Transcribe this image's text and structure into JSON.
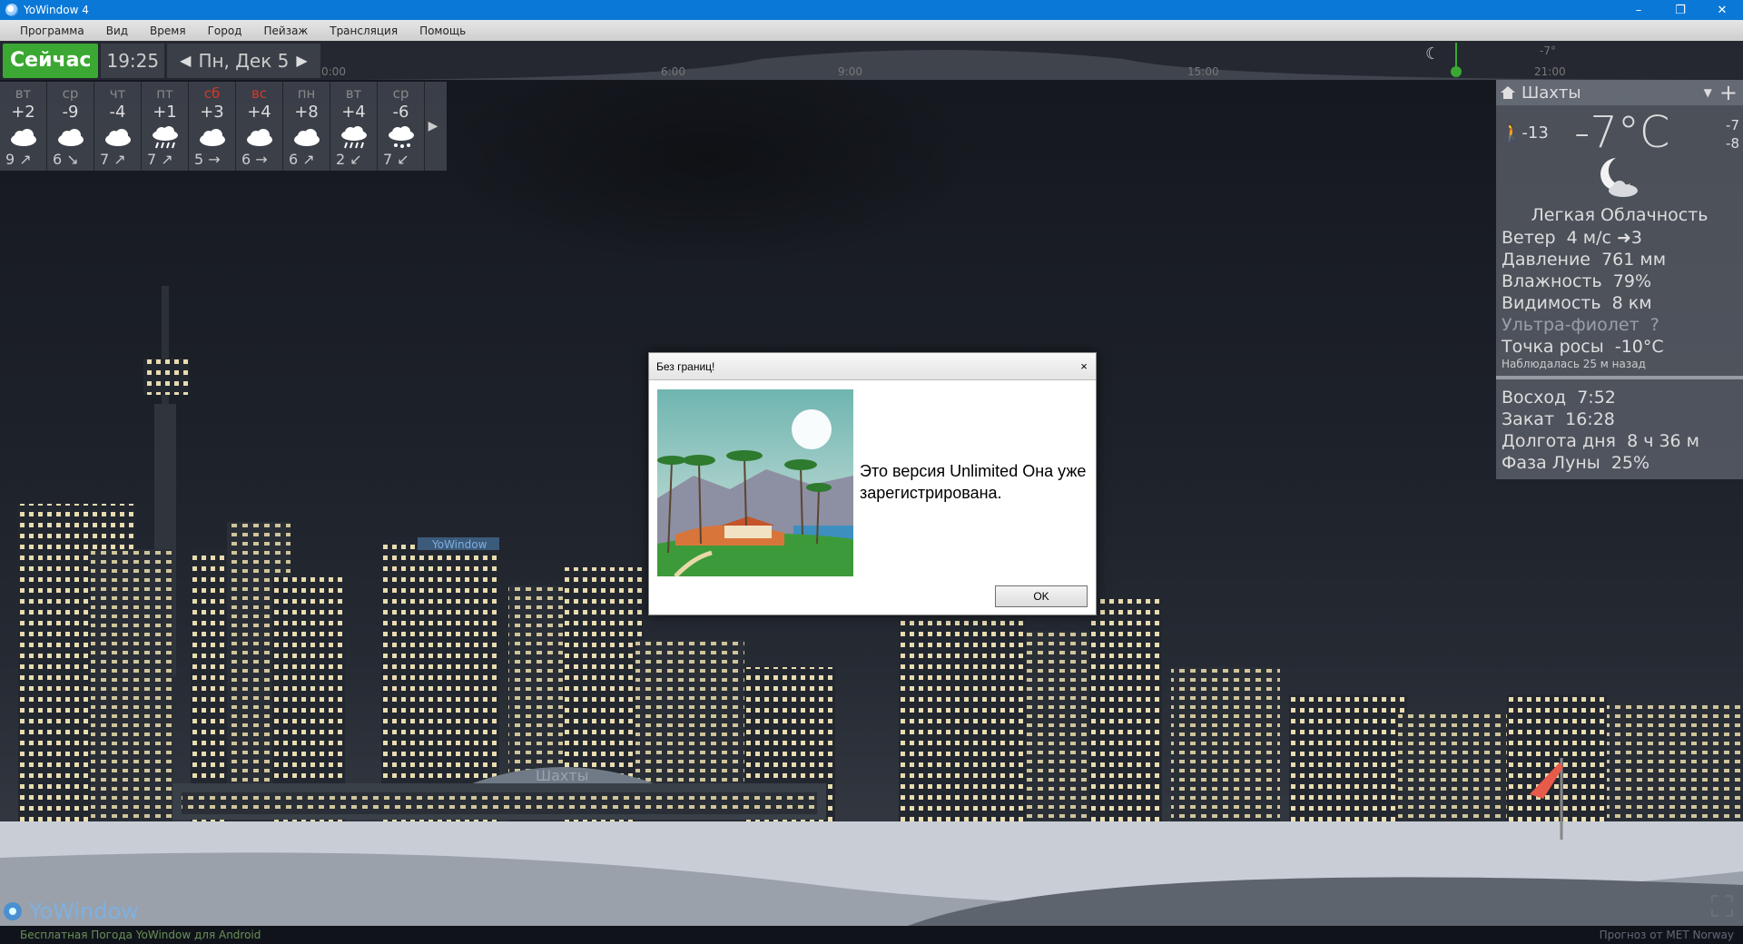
{
  "window": {
    "title": "YoWindow 4",
    "minimize": "–",
    "restore": "❐",
    "close": "✕"
  },
  "menu": [
    "Программа",
    "Вид",
    "Время",
    "Город",
    "Пейзаж",
    "Трансляция",
    "Помощь"
  ],
  "timebar": {
    "now_label": "Сейчас",
    "time": "19:25",
    "date": "Пн, Дек 5",
    "timeline_labels": [
      "0:00",
      "6:00",
      "9:00",
      "15:00",
      "21:00"
    ],
    "timeline_temp": "-7°"
  },
  "forecast": [
    {
      "day": "вт",
      "temp": "+2",
      "icon": "cloud-icon",
      "wind": "9 ↗",
      "weekend": false
    },
    {
      "day": "ср",
      "temp": "-9",
      "icon": "cloud-icon",
      "wind": "6 ↘",
      "weekend": false
    },
    {
      "day": "чт",
      "temp": "-4",
      "icon": "cloud-icon",
      "wind": "7 ↗",
      "weekend": false
    },
    {
      "day": "пт",
      "temp": "+1",
      "icon": "rain-icon",
      "wind": "7 ↗",
      "weekend": false
    },
    {
      "day": "сб",
      "temp": "+3",
      "icon": "cloud-icon",
      "wind": "5 →",
      "weekend": true
    },
    {
      "day": "вс",
      "temp": "+4",
      "icon": "cloud-icon",
      "wind": "6 →",
      "weekend": true
    },
    {
      "day": "пн",
      "temp": "+8",
      "icon": "cloud-icon",
      "wind": "6 ↗",
      "weekend": false
    },
    {
      "day": "вт",
      "temp": "+4",
      "icon": "rain-icon",
      "wind": "2 ↙",
      "weekend": false
    },
    {
      "day": "ср",
      "temp": "-6",
      "icon": "snow-icon",
      "wind": "7 ↙",
      "weekend": false
    }
  ],
  "panel": {
    "city": "Шахты",
    "feels_like": "-13",
    "temperature": "-7°C",
    "max": "-7",
    "min": "-8",
    "condition": "Легкая Облачность",
    "rows": [
      {
        "label": "Ветер",
        "value": "4 м/с ➜3",
        "dim": false
      },
      {
        "label": "Давление",
        "value": "761 мм",
        "dim": false
      },
      {
        "label": "Влажность",
        "value": "79%",
        "dim": false
      },
      {
        "label": "Видимость",
        "value": "8 км",
        "dim": false
      },
      {
        "label": "Ультра-фиолет",
        "value": "?",
        "dim": true
      },
      {
        "label": "Точка росы",
        "value": "-10°C",
        "dim": false
      }
    ],
    "observed": "Наблюдалась 25 м назад",
    "astro": [
      {
        "label": "Восход",
        "value": "7:52"
      },
      {
        "label": "Закат",
        "value": "16:28"
      },
      {
        "label": "Долгота дня",
        "value": "8 ч 36 м"
      },
      {
        "label": "Фаза Луны",
        "value": "25%"
      }
    ]
  },
  "scene": {
    "station_sign": "Шахты",
    "billboard": "YoWindow"
  },
  "dialog": {
    "title": "Без границ!",
    "close": "×",
    "message": "Это версия Unlimited Она уже зарегистрирована.",
    "ok": "OK"
  },
  "logo": "YoWindow",
  "status": {
    "left": "Бесплатная Погода YoWindow для Android",
    "right": "Прогноз от MET Norway"
  },
  "colors": {
    "titlebar": "#0a78d7",
    "now": "#3aa832",
    "weekend": "#d23a2a"
  }
}
